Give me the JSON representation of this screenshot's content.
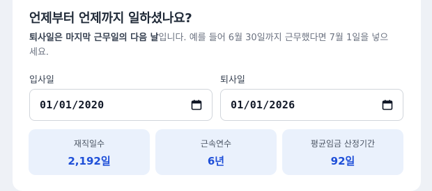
{
  "section": {
    "title": "언제부터 언제까지 일하셨나요?",
    "desc_bold": "퇴사일은 마지막 근무일의 다음 날",
    "desc_rest": "입니다. 예를 들어 6월 30일까지 근무했다면 7월 1일을 넣으세요."
  },
  "form": {
    "start_label": "입사일",
    "start_value": "01/01/2020",
    "end_label": "퇴사일",
    "end_value": "01/01/2026"
  },
  "stats": [
    {
      "label": "재직일수",
      "value": "2,192일"
    },
    {
      "label": "근속연수",
      "value": "6년"
    },
    {
      "label": "평균임금 산정기간",
      "value": "92일"
    }
  ],
  "colors": {
    "accent": "#1e4fd8",
    "stat_bg": "#eaf1fc",
    "page_bg": "#eef1f6"
  },
  "icons": {
    "date_picker": "calendar-icon"
  }
}
